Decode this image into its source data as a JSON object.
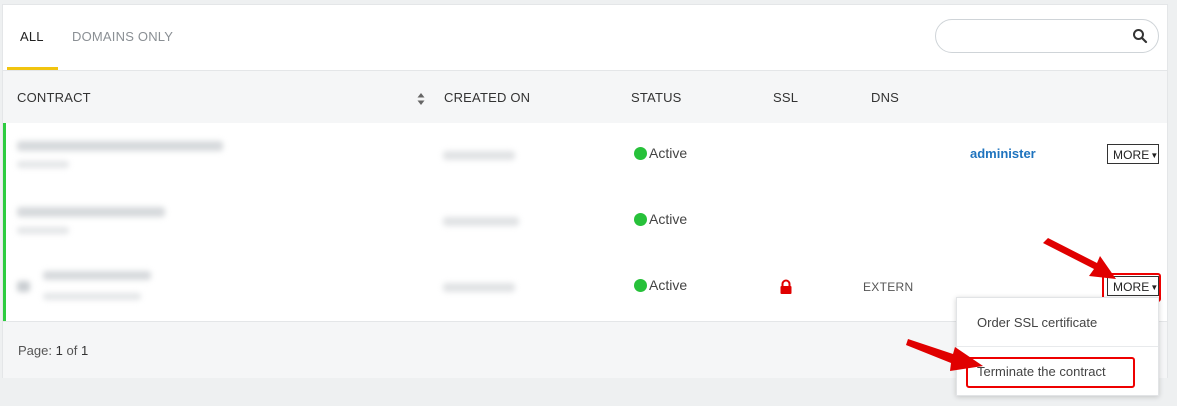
{
  "tabs": {
    "all": "ALL",
    "domains_only": "DOMAINS ONLY"
  },
  "search": {
    "placeholder": ""
  },
  "table": {
    "headers": {
      "contract": "CONTRACT",
      "created_on": "CREATED ON",
      "status": "STATUS",
      "ssl": "SSL",
      "dns": "DNS"
    },
    "rows": [
      {
        "status": "Active",
        "action_link": "administer",
        "more": "MORE"
      },
      {
        "status": "Active"
      },
      {
        "status": "Active",
        "dns": "EXTERN",
        "more": "MORE"
      }
    ]
  },
  "pagination": {
    "label": "Page:",
    "current": "1",
    "of": "of",
    "total": "1"
  },
  "dropdown": {
    "items": [
      "Order SSL certificate",
      "Terminate the contract"
    ]
  },
  "colors": {
    "active": "#27c13a",
    "accent_underline": "#f1c40f",
    "link": "#1e73be",
    "annotation": "#e00000",
    "row_marker": "#2ecc40"
  },
  "icons": {
    "search": "search-icon",
    "sort": "sort-icon",
    "ssl": "lock-icon",
    "caret": "caret-down-icon"
  }
}
